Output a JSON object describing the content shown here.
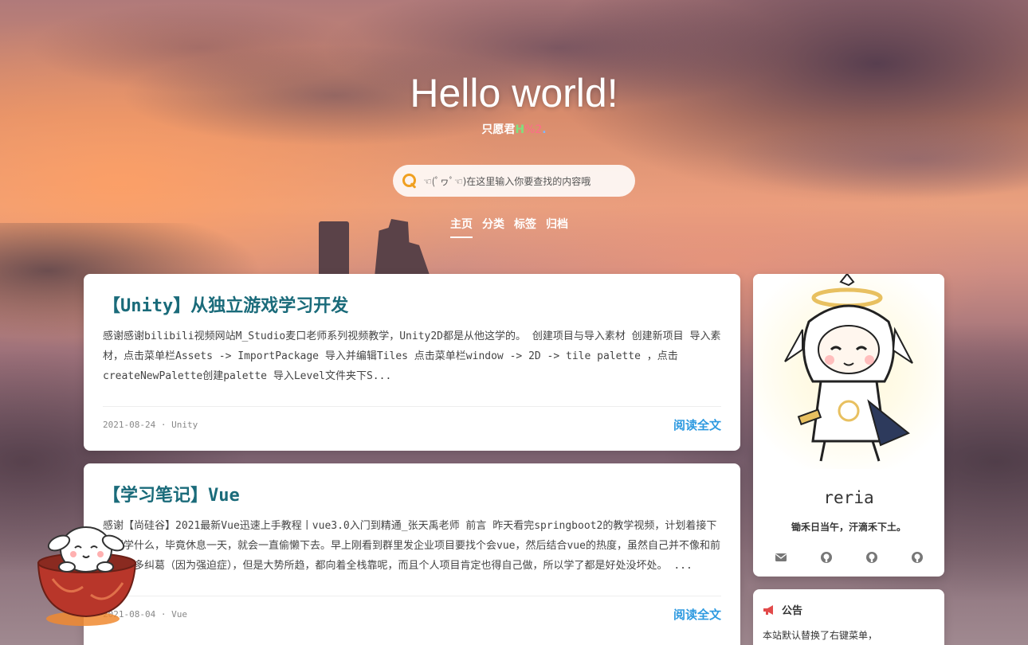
{
  "hero": {
    "title": "Hello world!",
    "subtitle_main": "只愿君",
    "subtitle_g": "H",
    "subtitle_r": "%2",
    "subtitle_b": "."
  },
  "search": {
    "placeholder": "☜(ﾟヮﾟ☜)在这里输入你要查找的内容哦"
  },
  "nav": {
    "items": [
      {
        "label": "主页",
        "active": true
      },
      {
        "label": "分类",
        "active": false
      },
      {
        "label": "标签",
        "active": false
      },
      {
        "label": "归档",
        "active": false
      }
    ]
  },
  "posts": [
    {
      "title": "【Unity】从独立游戏学习开发",
      "excerpt": "感谢感谢bilibili视频网站M_Studio麦口老师系列视频教学，Unity2D都是从他这学的。 创建项目与导入素材 创建新项目 导入素材，点击菜单栏Assets -> ImportPackage 导入并编辑Tiles 点击菜单栏window -> 2D -> tile palette ，点击createNewPalette创建palette 导入Level文件夹下S...",
      "meta": "2021-08-24 · Unity",
      "read_more": "阅读全文"
    },
    {
      "title": "【学习笔记】Vue",
      "excerpt": "感谢【尚硅谷】2021最新Vue迅速上手教程丨vue3.0入门到精通_张天禹老师 前言 昨天看完springboot2的教学视频，计划着接下来要学什么，毕竟休息一天，就会一直偷懒下去。早上刚看到群里发企业项目要找个会vue，然后结合vue的热度，虽然自己并不像和前端有太多纠葛（因为强迫症），但是大势所趋，都向着全栈靠呢，而且个人项目肯定也得自己做，所以学了都是好处没坏处。 ...",
      "meta": "2021-08-04 · Vue",
      "read_more": "阅读全文"
    }
  ],
  "profile": {
    "name": "reria",
    "motto": "锄禾日当午，汗滴禾下土。"
  },
  "notice": {
    "title": "公告",
    "text": "本站默认替换了右键菜单，"
  },
  "icons": {
    "search": "search-icon",
    "email": "envelope-icon",
    "github": "github-icon",
    "notice": "megaphone-icon"
  },
  "colors": {
    "accent": "#2e9ae0",
    "title": "#1a6b7a",
    "search_icon": "#f0a020"
  }
}
